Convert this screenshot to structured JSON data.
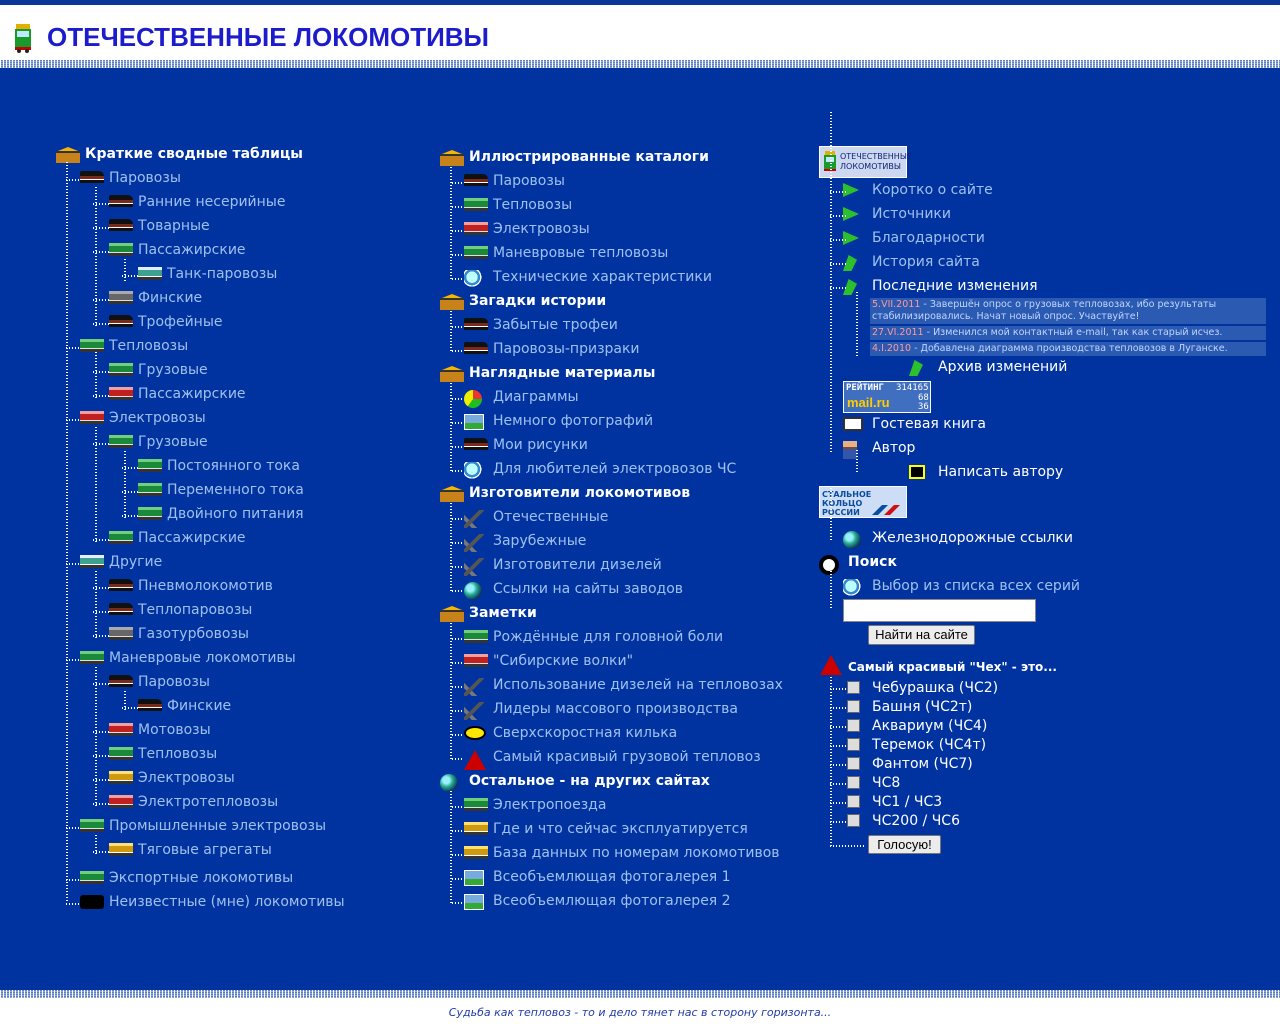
{
  "header": {
    "title": "ОТЕЧЕСТВЕННЫЕ ЛОКОМОТИВЫ"
  },
  "col1": {
    "heading": "Краткие сводные таблицы",
    "items": [
      "Паровозы",
      "Ранние несерийные",
      "Товарные",
      "Пассажирские",
      "Танк-паровозы",
      "Финские",
      "Трофейные",
      "Тепловозы",
      "Грузовые",
      "Пассажирские",
      "Электровозы",
      "Грузовые",
      "Постоянного тока",
      "Переменного тока",
      "Двойного питания",
      "Пассажирские",
      "Другие",
      "Пневмолокомотив",
      "Теплопаровозы",
      "Газотурбовозы",
      "Маневровые локомотивы",
      "Паровозы",
      "Финские",
      "Мотовозы",
      "Тепловозы",
      "Электровозы",
      "Электротепловозы",
      "Промышленные электровозы",
      "Тяговые агрегаты",
      "Экспортные локомотивы",
      "Неизвестные (мне) локомотивы"
    ]
  },
  "col2": {
    "sections": [
      {
        "title": "Иллюстрированные каталоги",
        "items": [
          "Паровозы",
          "Тепловозы",
          "Электровозы",
          "Маневровые тепловозы",
          "Технические характеристики"
        ]
      },
      {
        "title": "Загадки истории",
        "items": [
          "Забытые трофеи",
          "Паровозы-призраки"
        ]
      },
      {
        "title": "Наглядные материалы",
        "items": [
          "Диаграммы",
          "Немного фотографий",
          "Мои рисунки",
          "Для любителей электровозов ЧС"
        ]
      },
      {
        "title": "Изготовители локомотивов",
        "items": [
          "Отечественные",
          "Зарубежные",
          "Изготовители дизелей",
          "Ссылки на сайты заводов"
        ]
      },
      {
        "title": "Заметки",
        "items": [
          "Рождённые для головной боли",
          "\"Сибирские волки\"",
          "Использование дизелей на тепловозах",
          "Лидеры массового производства",
          "Сверхскоростная килька",
          "Самый красивый грузовой тепловоз"
        ]
      },
      {
        "title": "Остальное - на других сайтах",
        "items": [
          "Электропоезда",
          "Где и что сейчас эксплуатируется",
          "База данных по номерам локомотивов",
          "Всеобъемлющая фотогалерея 1",
          "Всеобъемлющая фотогалерея 2"
        ]
      }
    ]
  },
  "col3": {
    "banner1_text": "ОТЕЧЕСТВЕННЫЕ ЛОКОМОТИВЫ",
    "links": [
      "Коротко о сайте",
      "Источники",
      "Благодарности",
      "История сайта",
      "Последние изменения"
    ],
    "news": [
      {
        "date": "5.VII.2011",
        "text": " - Завершён опрос о грузовых тепловозах, ибо результаты стабилизировались. Начат новый опрос. Участвуйте!"
      },
      {
        "date": "27.VI.2011",
        "text": " - Изменился мой контактный e-mail, так как старый исчез."
      },
      {
        "date": "4.I.2010",
        "text": " - Добавлена диаграмма производства тепловозов в Луганске."
      }
    ],
    "archive": "Архив изменений",
    "rating": {
      "label": "РЕЙТИНГ",
      "n1": "314165",
      "brand": "mail.ru",
      "n2": "68",
      "n3": "36"
    },
    "guestbook": "Гостевая книга",
    "author": "Автор",
    "write_author": "Написать автору",
    "banner2_text": "СТАЛЬНОЕ КОЛЬЦО РОССИИ",
    "rail_links": "Железнодорожные ссылки",
    "search_title": "Поиск",
    "search_list": "Выбор из списка всех серий",
    "search_input_value": "",
    "search_button": "Найти на сайте",
    "poll_title": "Самый красивый \"Чех\" - это...",
    "poll_options": [
      "Чебурашка (ЧС2)",
      "Башня (ЧС2т)",
      "Аквариум (ЧС4)",
      "Теремок (ЧС4т)",
      "Фантом (ЧС7)",
      "ЧС8",
      "ЧС1 / ЧС3",
      "ЧС200 / ЧС6"
    ],
    "vote_button": "Голосую!"
  },
  "footer": {
    "text": "Судьба как тепловоз - то и дело тянет нас в сторону горизонта..."
  }
}
